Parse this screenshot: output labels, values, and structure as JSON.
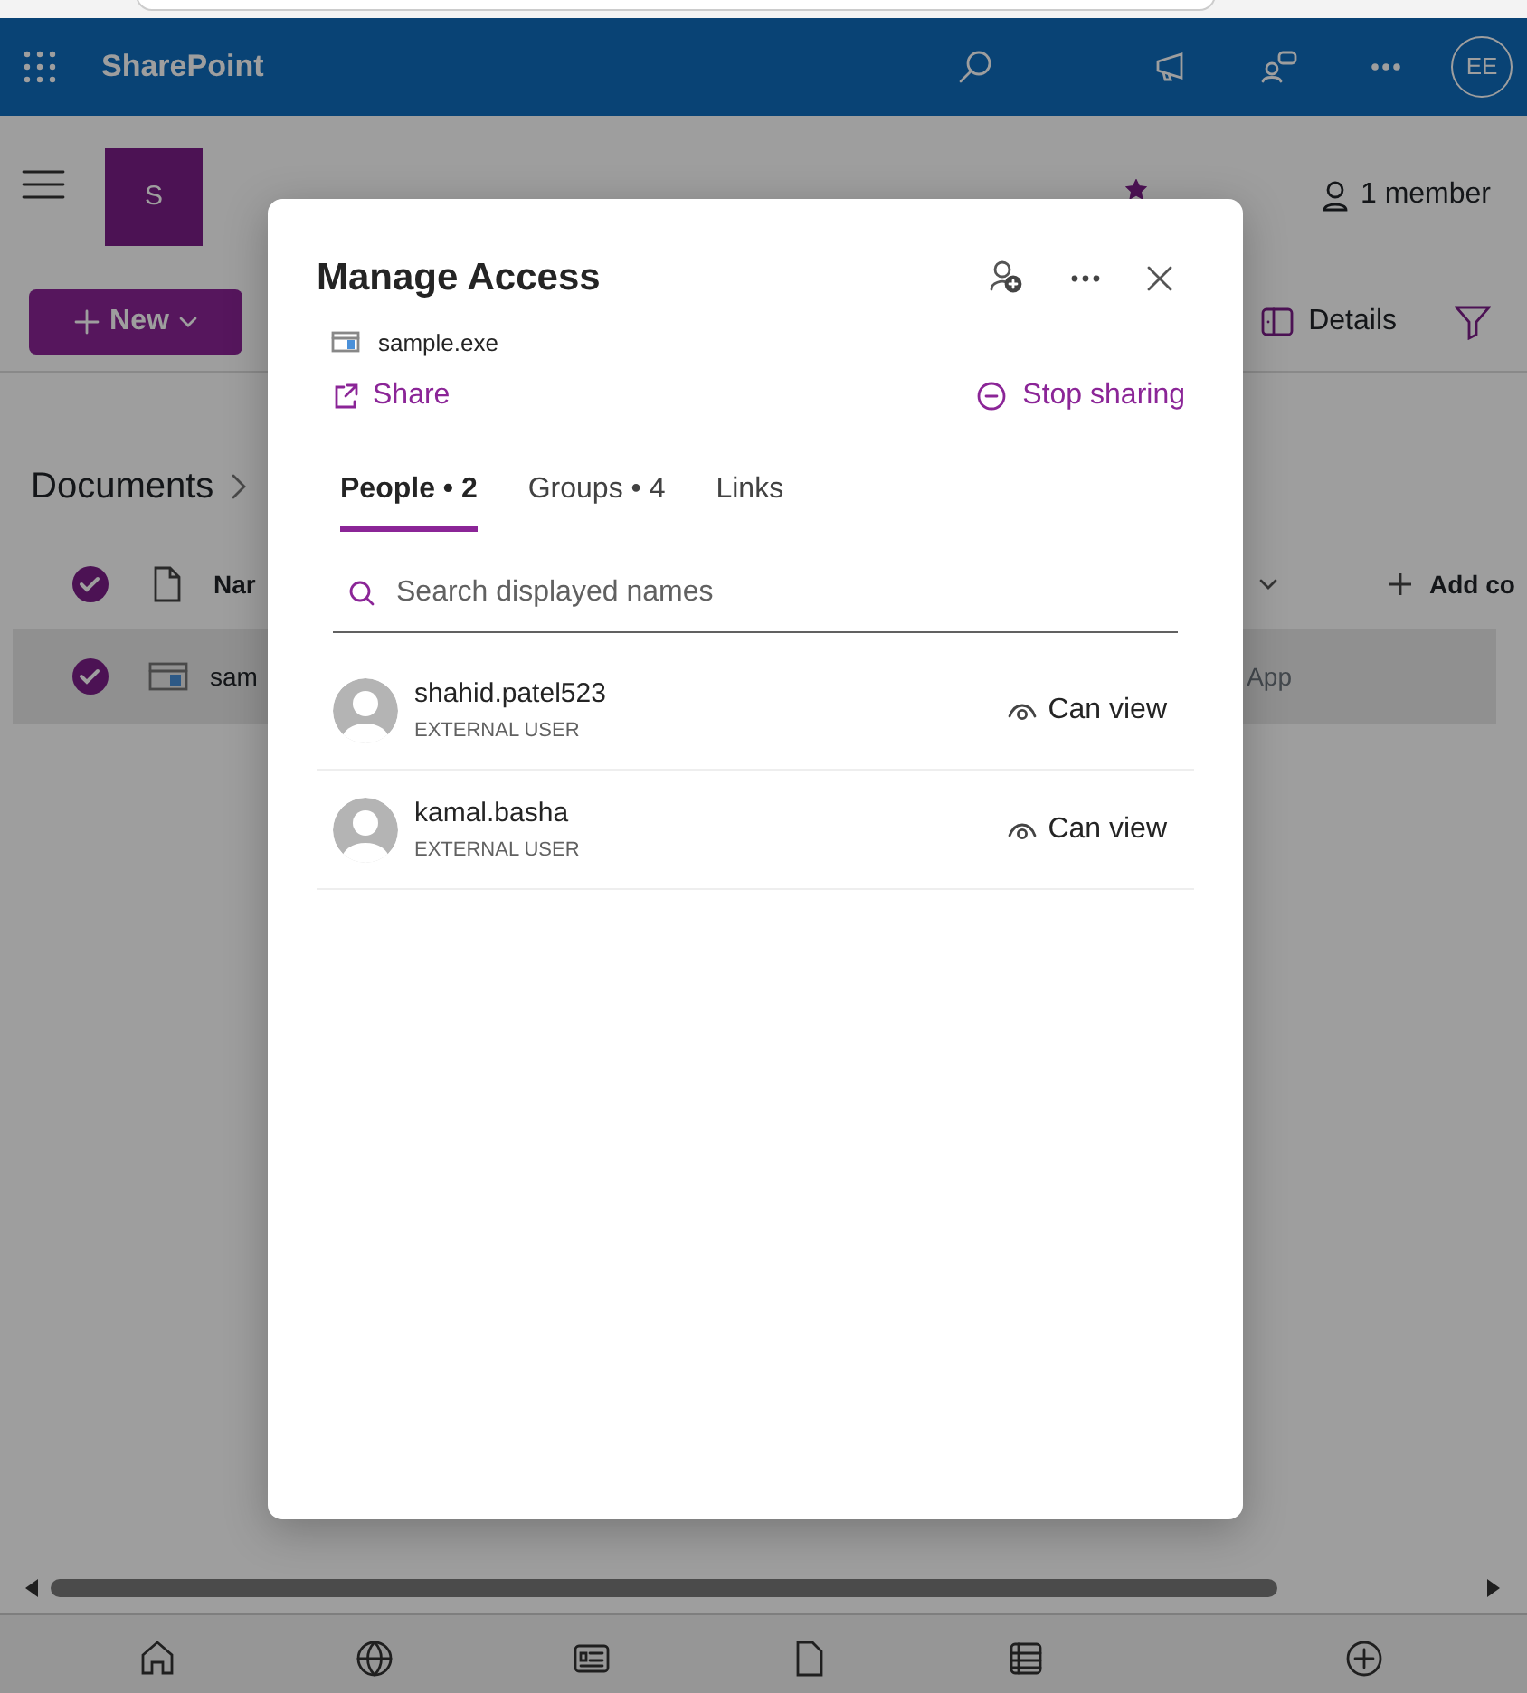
{
  "app_bar": {
    "app_name": "SharePoint",
    "avatar": "EE"
  },
  "site": {
    "logo_letter": "S",
    "members": "1 member"
  },
  "command_bar": {
    "new_button": "New",
    "details": "Details"
  },
  "library": {
    "breadcrumb": "Documents",
    "select_all_checked": true,
    "columns": [
      {
        "label": "Nar"
      },
      {
        "label": "Add co"
      }
    ],
    "rows": [
      {
        "name": "sam",
        "column_3": "App",
        "selected": true
      }
    ]
  },
  "dialog": {
    "title": "Manage Access",
    "file_name": "sample.exe",
    "share": "Share",
    "stop_sharing": "Stop sharing",
    "tabs": [
      {
        "label": "People • 2",
        "selected": true
      },
      {
        "label": "Groups • 4",
        "selected": false
      },
      {
        "label": "Links",
        "selected": false
      }
    ],
    "search": {
      "placeholder": "Search displayed names"
    },
    "people": [
      {
        "name": "shahid.patel523",
        "type": "EXTERNAL USER",
        "permission": "Can view"
      },
      {
        "name": "kamal.basha",
        "type": "EXTERNAL USER",
        "permission": "Can view"
      }
    ]
  }
}
